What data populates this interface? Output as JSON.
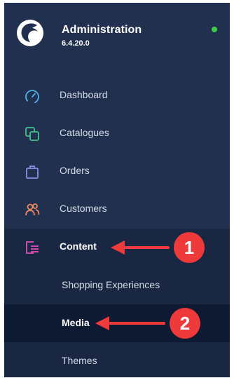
{
  "app": {
    "title": "Administration",
    "version": "6.4.20.0",
    "status_color": "#37d046"
  },
  "nav": {
    "items": [
      {
        "label": "Dashboard",
        "icon": "dashboard-gauge-icon",
        "color": "#4fb2e8"
      },
      {
        "label": "Catalogues",
        "icon": "catalogues-icon",
        "color": "#45c28a"
      },
      {
        "label": "Orders",
        "icon": "shopping-bag-icon",
        "color": "#8f8dea"
      },
      {
        "label": "Customers",
        "icon": "users-icon",
        "color": "#f08a60"
      },
      {
        "label": "Content",
        "icon": "content-icon",
        "color": "#e04fb8"
      }
    ],
    "content_sub_items": [
      {
        "label": "Shopping Experiences"
      },
      {
        "label": "Media"
      },
      {
        "label": "Themes"
      }
    ]
  },
  "annotations": {
    "badge_1": "1",
    "badge_2": "2",
    "color": "#ee3a3a"
  }
}
